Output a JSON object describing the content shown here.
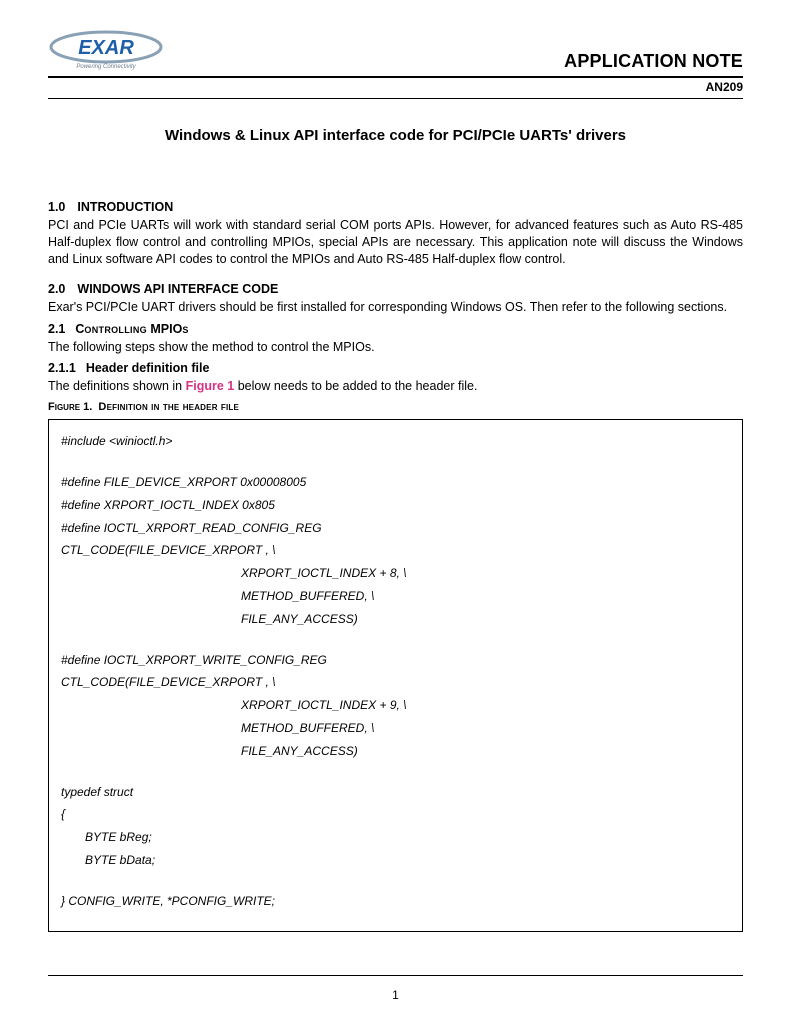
{
  "header": {
    "logo_brand": "EXAR",
    "logo_tagline": "Powering Connectivity",
    "app_note_label": "APPLICATION NOTE",
    "doc_number": "AN209"
  },
  "title": "Windows & Linux API interface code for PCI/PCIe UARTs' drivers",
  "sections": {
    "s1": {
      "num": "1.0",
      "heading": "INTRODUCTION",
      "body": "PCI and PCIe UARTs will work with standard serial COM ports APIs. However, for advanced features such as Auto RS-485 Half-duplex flow control and controlling MPIOs, special APIs are necessary. This application note will discuss the Windows and Linux software API codes to control the MPIOs and Auto RS-485 Half-duplex flow control."
    },
    "s2": {
      "num": "2.0",
      "heading": "WINDOWS API INTERFACE CODE",
      "body": "Exar's PCI/PCIe UART drivers should be first installed for corresponding Windows OS. Then refer to the following sections."
    },
    "s2_1": {
      "num": "2.1",
      "heading_pre": "C",
      "heading_sc": "ontrolling",
      "heading_post": " MPIO",
      "heading_suf": "s",
      "body": "The following steps show the method to control the MPIOs."
    },
    "s2_1_1": {
      "num": "2.1.1",
      "heading": "Header definition file",
      "body_pre": "The definitions shown in ",
      "fig_ref": "Figure 1",
      "body_post": " below needs to be added to the header file."
    }
  },
  "figure1": {
    "caption_num": "Figure 1.",
    "caption_text": "Definition in the header file",
    "lines": {
      "l1": "#include <winioctl.h>",
      "l2": "#define FILE_DEVICE_XRPORT  0x00008005",
      "l3": "#define XRPORT_IOCTL_INDEX  0x805",
      "l4": "#define IOCTL_XRPORT_READ_CONFIG_REG",
      "l5": "CTL_CODE(FILE_DEVICE_XRPORT , \\",
      "l6": "XRPORT_IOCTL_INDEX + 8,  \\",
      "l7": "METHOD_BUFFERED,      \\",
      "l8": "FILE_ANY_ACCESS)",
      "l9": "#define IOCTL_XRPORT_WRITE_CONFIG_REG",
      "l10": "CTL_CODE(FILE_DEVICE_XRPORT , \\",
      "l11": "XRPORT_IOCTL_INDEX + 9,  \\",
      "l12": "METHOD_BUFFERED,      \\",
      "l13": "FILE_ANY_ACCESS)",
      "l14": "typedef struct",
      "l15": "{",
      "l16": "BYTE    bReg;",
      "l17": "BYTE    bData;",
      "l18": "} CONFIG_WRITE, *PCONFIG_WRITE;"
    }
  },
  "page_number": "1"
}
